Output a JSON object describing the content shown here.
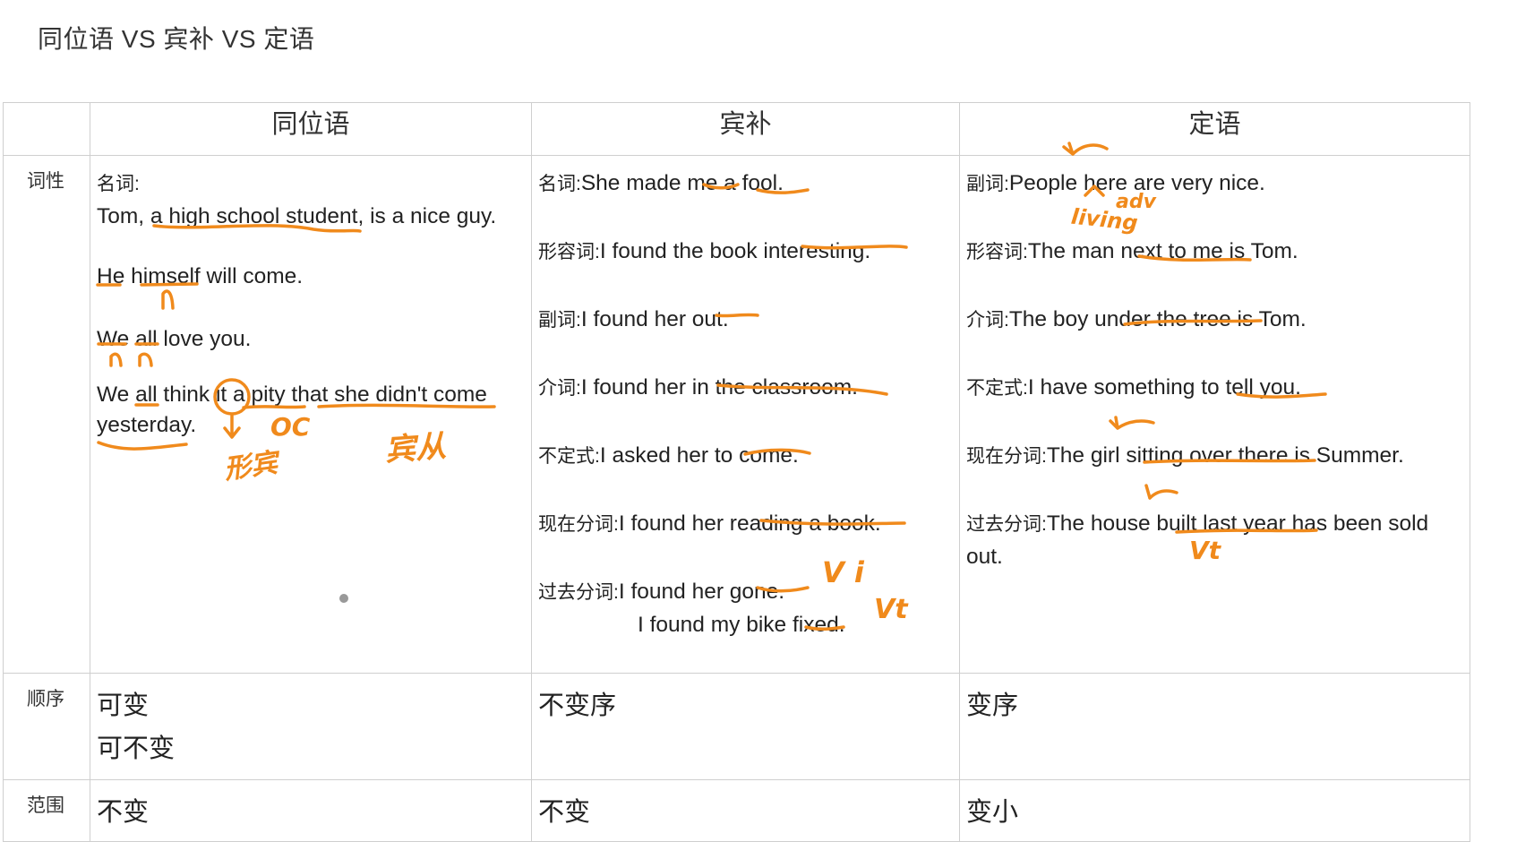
{
  "title": "同位语 VS 宾补 VS 定语",
  "headers": [
    "同位语",
    "宾补",
    "定语"
  ],
  "row_labels": {
    "pos": "词性",
    "order": "顺序",
    "range": "范围"
  },
  "appositive": {
    "label": "名词:",
    "lines": [
      "Tom, a high school student, is a nice guy.",
      "He himself will come.",
      "We all love you.",
      "We all think it a pity that she didn't come",
      "yesterday."
    ]
  },
  "complement": [
    {
      "label": "名词:",
      "text": "She made me a fool."
    },
    {
      "label": "形容词:",
      "text": "I found the book interesting."
    },
    {
      "label": "副词:",
      "text": "I found her out."
    },
    {
      "label": "介词:",
      "text": "I found her in the classroom."
    },
    {
      "label": "不定式:",
      "text": "I asked her to come."
    },
    {
      "label": "现在分词:",
      "text": "I found her reading a book."
    },
    {
      "label": "过去分词:",
      "text": "I found her gone."
    },
    {
      "label": "",
      "text": "I found my bike fixed."
    }
  ],
  "attributive": [
    {
      "label": "副词:",
      "text": "People here are very nice."
    },
    {
      "label": "形容词:",
      "text": "The man next to me is Tom."
    },
    {
      "label": "介词:",
      "text": "The boy under the tree is Tom."
    },
    {
      "label": "不定式:",
      "text": "I have something to tell you."
    },
    {
      "label": "现在分词:",
      "text": "The girl sitting over there is Summer."
    },
    {
      "label": "过去分词:",
      "text": "The house built last year has been sold"
    },
    {
      "label": "",
      "text": "out."
    }
  ],
  "order": {
    "appositive": [
      "可变",
      "可不变"
    ],
    "complement": "不变序",
    "attributive": "变序"
  },
  "range": {
    "appositive": "不变",
    "complement": "不变",
    "attributive": "变小"
  },
  "annotations": {
    "oc": "OC",
    "vi": "V i",
    "vt": "Vt",
    "adv": "adv",
    "living": "living",
    "vt2": "Vt",
    "formal_obj": "形宾",
    "real_clause": "宾从",
    "n": "n"
  },
  "ink_color": "#f08a1c"
}
